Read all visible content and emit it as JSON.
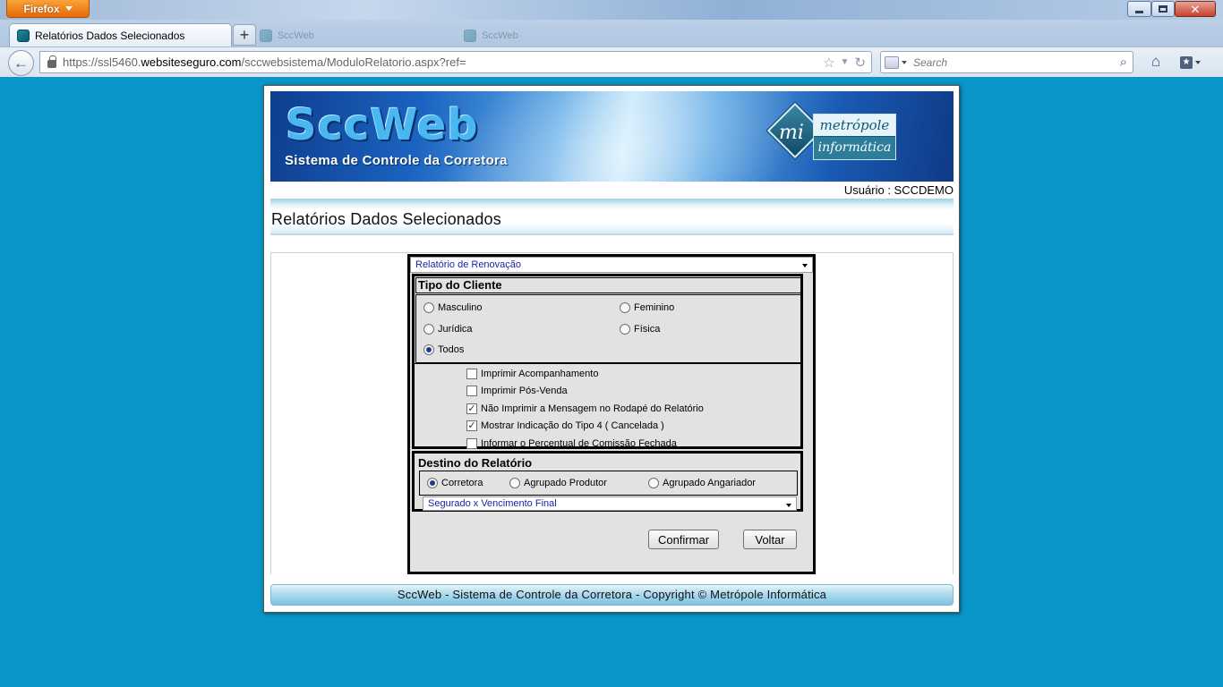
{
  "browser": {
    "app_button": "Firefox",
    "active_tab_title": "Relatórios Dados Selecionados",
    "ghost_tabs": [
      "SccWeb",
      "SccWeb"
    ],
    "url_prefix": "https://ssl5460.",
    "url_host": "websiteseguro.com",
    "url_path": "/sccwebsistema/ModuloRelatorio.aspx?ref=",
    "search_placeholder": "Search",
    "new_tab_label": "+"
  },
  "banner": {
    "brand_title": "SccWeb",
    "brand_subtitle": "Sistema de Controle da Corretora",
    "logo_mark": "mi",
    "logo_top": "metrópole",
    "logo_bottom": "informática"
  },
  "header": {
    "user_line": "Usuário : SCCDEMO",
    "page_title": "Relatórios Dados Selecionados"
  },
  "form": {
    "report_select_value": "Relatório de Renovação",
    "tipo_cliente": {
      "heading": "Tipo do Cliente",
      "options": [
        {
          "label": "Masculino",
          "checked": false
        },
        {
          "label": "Feminino",
          "checked": false
        },
        {
          "label": "Jurídica",
          "checked": false
        },
        {
          "label": "Física",
          "checked": false
        },
        {
          "label": "Todos",
          "checked": true
        }
      ]
    },
    "checkboxes": [
      {
        "label": "Imprimir Acompanhamento",
        "checked": false
      },
      {
        "label": "Imprimir Pós-Venda",
        "checked": false
      },
      {
        "label": "Não Imprimir a Mensagem no Rodapé do Relatório",
        "checked": true
      },
      {
        "label": "Mostrar Indicação do Tipo 4 ( Cancelada )",
        "checked": true
      },
      {
        "label": "Informar o Percentual de Comissão Fechada",
        "checked": false
      }
    ],
    "destino": {
      "heading": "Destino do Relatório",
      "options": [
        {
          "label": "Corretora",
          "checked": true
        },
        {
          "label": "Agrupado Produtor",
          "checked": false
        },
        {
          "label": "Agrupado Angariador",
          "checked": false
        }
      ],
      "order_select_value": "Segurado x Vencimento Final"
    },
    "confirm_label": "Confirmar",
    "back_label": "Voltar"
  },
  "footer": {
    "text": "SccWeb - Sistema de Controle da Corretora - Copyright © Metrópole Informática"
  },
  "colors": {
    "desktop_bg": "#0a96c8",
    "select_text": "#1a24a8",
    "firefox_orange": "#e66a08"
  }
}
